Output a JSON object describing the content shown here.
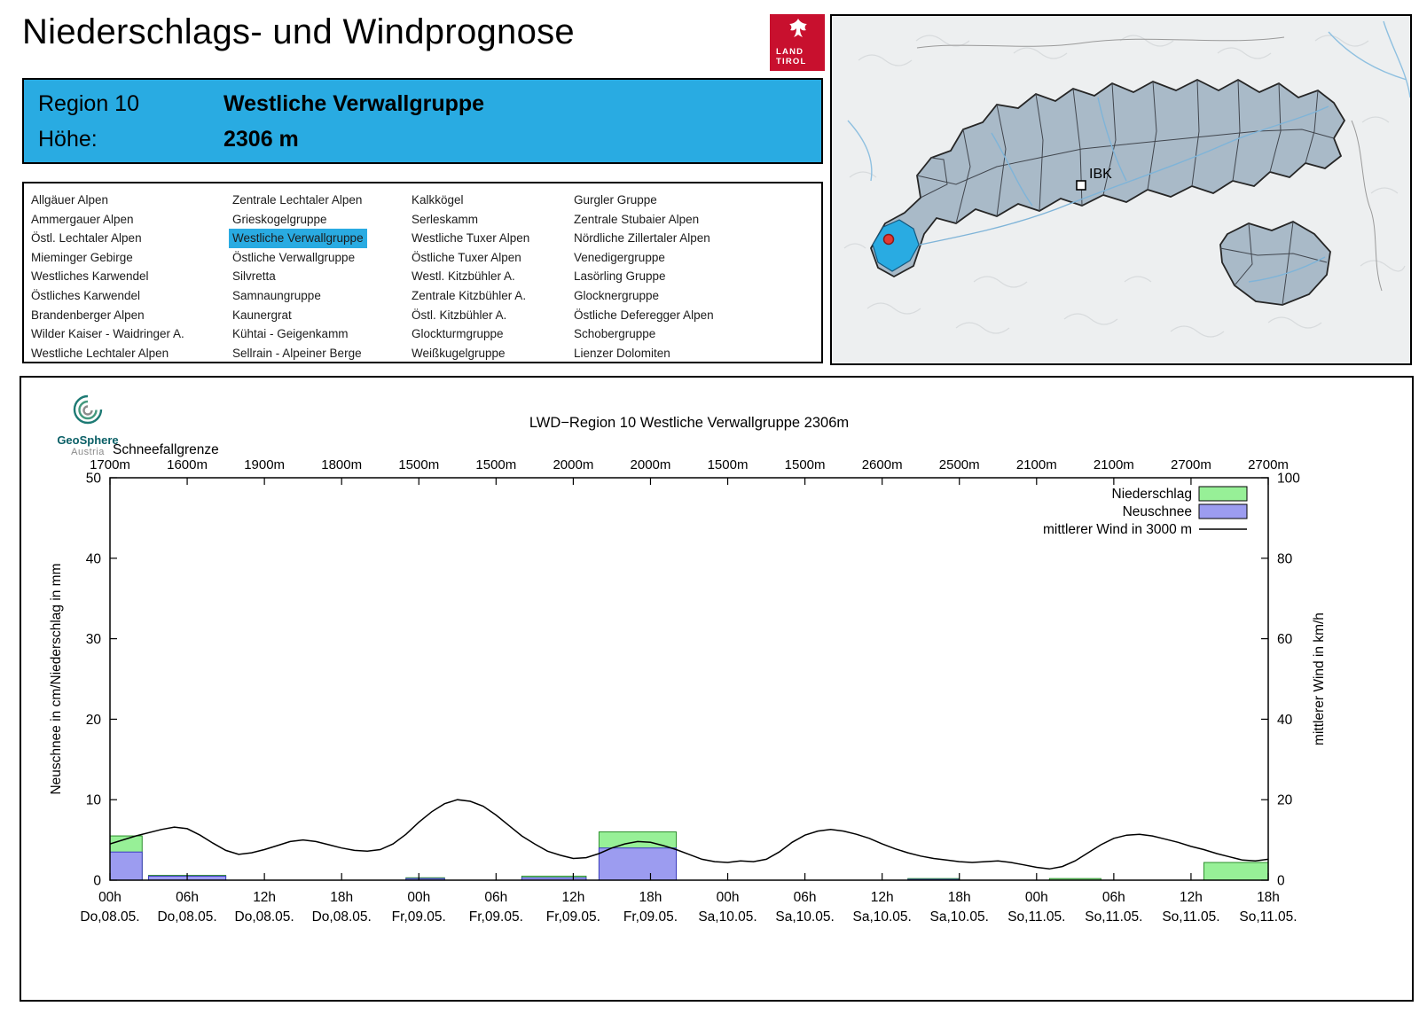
{
  "page": {
    "title": "Niederschlags- und Windprognose"
  },
  "land_tirol_logo": {
    "line1": "LAND",
    "line2": "TIROL"
  },
  "map": {
    "city_label": "IBK"
  },
  "region_header": {
    "region_label": "Region 10",
    "region_name": "Westliche Verwallgruppe",
    "altitude_label": "Höhe:",
    "altitude_value": "2306 m"
  },
  "region_list": {
    "selected": "Westliche Verwallgruppe",
    "columns": [
      [
        "Allgäuer Alpen",
        "Ammergauer Alpen",
        "Östl. Lechtaler Alpen",
        "Mieminger Gebirge",
        "Westliches Karwendel",
        "Östliches Karwendel",
        "Brandenberger Alpen",
        "Wilder Kaiser - Waidringer A.",
        "Westliche Lechtaler Alpen"
      ],
      [
        "Zentrale Lechtaler Alpen",
        "Grieskogelgruppe",
        "Westliche Verwallgruppe",
        "Östliche Verwallgruppe",
        "Silvretta",
        "Samnaungruppe",
        "Kaunergrat",
        "Kühtai - Geigenkamm",
        "Sellrain - Alpeiner Berge"
      ],
      [
        "Kalkkögel",
        "Serleskamm",
        "Westliche Tuxer Alpen",
        "Östliche Tuxer Alpen",
        "Westl. Kitzbühler A.",
        "Zentrale Kitzbühler A.",
        "Östl. Kitzbühler A.",
        "Glockturmgruppe",
        "Weißkugelgruppe"
      ],
      [
        "Gurgler Gruppe",
        "Zentrale Stubaier Alpen",
        "Nördliche Zillertaler Alpen",
        "Venedigergruppe",
        "Lasörling Gruppe",
        "Glocknergruppe",
        "Östliche Deferegger Alpen",
        "Schobergruppe",
        "Lienzer Dolomiten"
      ]
    ]
  },
  "geosphere_logo": {
    "name": "GeoSphere",
    "country": "Austria"
  },
  "chart_data": {
    "type": "bar+line",
    "title": "LWD−Region 10 Westliche Verwallgruppe 2306m",
    "snowline_label": "Schneefallgrenze",
    "snowline_values": [
      "1700m",
      "1600m",
      "1900m",
      "1800m",
      "1500m",
      "1500m",
      "2000m",
      "2000m",
      "1500m",
      "1500m",
      "2600m",
      "2500m",
      "2100m",
      "2100m",
      "2700m",
      "2700m"
    ],
    "x_ticks": [
      {
        "t": "00h",
        "d": "Do,08.05."
      },
      {
        "t": "06h",
        "d": "Do,08.05."
      },
      {
        "t": "12h",
        "d": "Do,08.05."
      },
      {
        "t": "18h",
        "d": "Do,08.05."
      },
      {
        "t": "00h",
        "d": "Fr,09.05."
      },
      {
        "t": "06h",
        "d": "Fr,09.05."
      },
      {
        "t": "12h",
        "d": "Fr,09.05."
      },
      {
        "t": "18h",
        "d": "Fr,09.05."
      },
      {
        "t": "00h",
        "d": "Sa,10.05."
      },
      {
        "t": "06h",
        "d": "Sa,10.05."
      },
      {
        "t": "12h",
        "d": "Sa,10.05."
      },
      {
        "t": "18h",
        "d": "Sa,10.05."
      },
      {
        "t": "00h",
        "d": "So,11.05."
      },
      {
        "t": "06h",
        "d": "So,11.05."
      },
      {
        "t": "12h",
        "d": "So,11.05."
      },
      {
        "t": "18h",
        "d": "So,11.05."
      }
    ],
    "ylabel_left": "Neuschnee in cm/Niederschlag in mm",
    "ylabel_right": "mittlerer Wind in km/h",
    "ylim_left": [
      0,
      50
    ],
    "ylim_right": [
      0,
      100
    ],
    "yticks_left": [
      0,
      10,
      20,
      30,
      40,
      50
    ],
    "yticks_right": [
      0,
      20,
      40,
      60,
      80,
      100
    ],
    "hours_span": 90,
    "legend": [
      {
        "label": "Niederschlag",
        "type": "box",
        "fill": "#97f097"
      },
      {
        "label": "Neuschnee",
        "type": "box",
        "fill": "#9c9cf0"
      },
      {
        "label": "mittlerer Wind in 3000 m",
        "type": "line",
        "stroke": "#000000"
      }
    ],
    "colors": {
      "niederschlag_fill": "#97f097",
      "niederschlag_stroke": "#2f8f2f",
      "neuschnee_fill": "#9c9cf0",
      "neuschnee_stroke": "#3c3cc0",
      "wind": "#000000",
      "accent_blue": "#29abe2"
    },
    "bars": [
      {
        "start_h": 0,
        "end_h": 2.5,
        "niederschlag_mm": 5.5,
        "neuschnee_cm": 3.5
      },
      {
        "start_h": 3,
        "end_h": 9,
        "niederschlag_mm": 0.6,
        "neuschnee_cm": 0.5
      },
      {
        "start_h": 23,
        "end_h": 26,
        "niederschlag_mm": 0.3,
        "neuschnee_cm": 0.2
      },
      {
        "start_h": 32,
        "end_h": 37,
        "niederschlag_mm": 0.5,
        "neuschnee_cm": 0.3
      },
      {
        "start_h": 38,
        "end_h": 44,
        "niederschlag_mm": 6.0,
        "neuschnee_cm": 4.0
      },
      {
        "start_h": 62,
        "end_h": 66,
        "niederschlag_mm": 0.2,
        "neuschnee_cm": 0.1
      },
      {
        "start_h": 73,
        "end_h": 77,
        "niederschlag_mm": 0.2,
        "neuschnee_cm": 0.0
      },
      {
        "start_h": 85,
        "end_h": 90,
        "niederschlag_mm": 2.2,
        "neuschnee_cm": 0.0
      }
    ],
    "wind_line_kmh": [
      [
        0,
        9
      ],
      [
        2,
        11
      ],
      [
        4,
        12.6
      ],
      [
        5,
        13.2
      ],
      [
        6,
        12.8
      ],
      [
        7,
        11.2
      ],
      [
        8,
        9.2
      ],
      [
        9,
        7.4
      ],
      [
        10,
        6.4
      ],
      [
        11,
        6.8
      ],
      [
        12,
        7.6
      ],
      [
        13,
        8.6
      ],
      [
        14,
        9.6
      ],
      [
        15,
        10
      ],
      [
        16,
        9.6
      ],
      [
        17,
        8.8
      ],
      [
        18,
        8
      ],
      [
        19,
        7.4
      ],
      [
        20,
        7.2
      ],
      [
        21,
        7.6
      ],
      [
        22,
        9
      ],
      [
        23,
        11.4
      ],
      [
        24,
        14.4
      ],
      [
        25,
        17
      ],
      [
        26,
        19
      ],
      [
        27,
        20
      ],
      [
        28,
        19.6
      ],
      [
        29,
        18.4
      ],
      [
        30,
        16.2
      ],
      [
        31,
        13.6
      ],
      [
        32,
        11
      ],
      [
        33,
        9
      ],
      [
        34,
        7.2
      ],
      [
        35,
        6.2
      ],
      [
        36,
        5.4
      ],
      [
        37,
        5.6
      ],
      [
        38,
        6.6
      ],
      [
        39,
        8
      ],
      [
        40,
        9
      ],
      [
        41,
        9.6
      ],
      [
        42,
        9.4
      ],
      [
        43,
        8.6
      ],
      [
        44,
        7.6
      ],
      [
        45,
        6.4
      ],
      [
        46,
        5.2
      ],
      [
        47,
        4.6
      ],
      [
        48,
        4.4
      ],
      [
        49,
        4.8
      ],
      [
        50,
        4.6
      ],
      [
        51,
        5.2
      ],
      [
        52,
        7
      ],
      [
        53,
        9.4
      ],
      [
        54,
        11.2
      ],
      [
        55,
        12.2
      ],
      [
        56,
        12.6
      ],
      [
        57,
        12.2
      ],
      [
        58,
        11.4
      ],
      [
        59,
        10.4
      ],
      [
        60,
        9
      ],
      [
        61,
        7.8
      ],
      [
        62,
        6.8
      ],
      [
        63,
        6
      ],
      [
        64,
        5.4
      ],
      [
        65,
        5
      ],
      [
        66,
        4.6
      ],
      [
        67,
        4.4
      ],
      [
        68,
        4.6
      ],
      [
        69,
        4.8
      ],
      [
        70,
        4.4
      ],
      [
        71,
        3.8
      ],
      [
        72,
        3.2
      ],
      [
        73,
        2.8
      ],
      [
        74,
        3.4
      ],
      [
        75,
        4.8
      ],
      [
        76,
        6.8
      ],
      [
        77,
        8.8
      ],
      [
        78,
        10.4
      ],
      [
        79,
        11.2
      ],
      [
        80,
        11.4
      ],
      [
        81,
        11
      ],
      [
        82,
        10.2
      ],
      [
        83,
        9.4
      ],
      [
        84,
        8.4
      ],
      [
        85,
        7.6
      ],
      [
        86,
        6.6
      ],
      [
        87,
        5.8
      ],
      [
        88,
        5
      ],
      [
        89,
        4.8
      ],
      [
        90,
        5.2
      ]
    ]
  }
}
